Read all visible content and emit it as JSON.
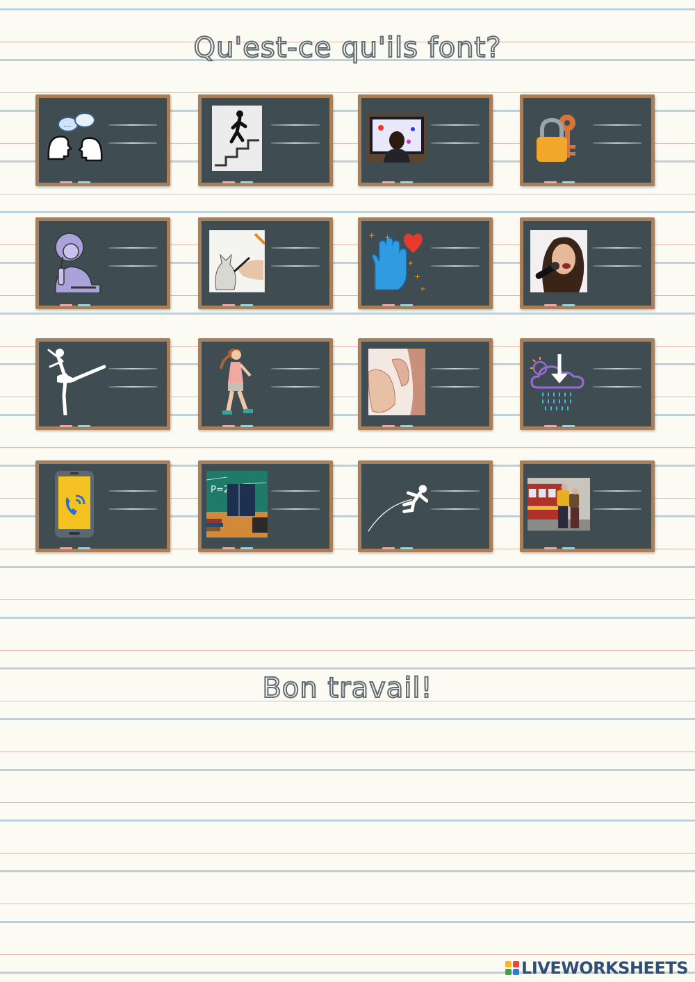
{
  "page": {
    "title": "Qu'est-ce qu'ils font?",
    "closing": "Bon travail!"
  },
  "cards": [
    {
      "icon": "talking-heads-icon"
    },
    {
      "icon": "climbing-stairs-icon"
    },
    {
      "icon": "watching-tv-icon"
    },
    {
      "icon": "lock-and-key-icon"
    },
    {
      "icon": "eating-person-icon"
    },
    {
      "icon": "drawing-icon"
    },
    {
      "icon": "hand-and-heart-icon"
    },
    {
      "icon": "singing-girl-icon"
    },
    {
      "icon": "ballet-dancer-icon"
    },
    {
      "icon": "walking-girl-icon"
    },
    {
      "icon": "listening-ear-icon"
    },
    {
      "icon": "rain-cloud-icon"
    },
    {
      "icon": "phone-call-icon"
    },
    {
      "icon": "reading-book-icon"
    },
    {
      "icon": "jumping-person-icon"
    },
    {
      "icon": "travelers-icon"
    }
  ],
  "footer": {
    "brand": "LIVEWORKSHEETS",
    "logo_letters": [
      "L",
      "I",
      "V",
      "E"
    ]
  },
  "colors": {
    "board": "#3f4c52",
    "frame": "#a97f59",
    "brand": "#2e4f7a"
  }
}
